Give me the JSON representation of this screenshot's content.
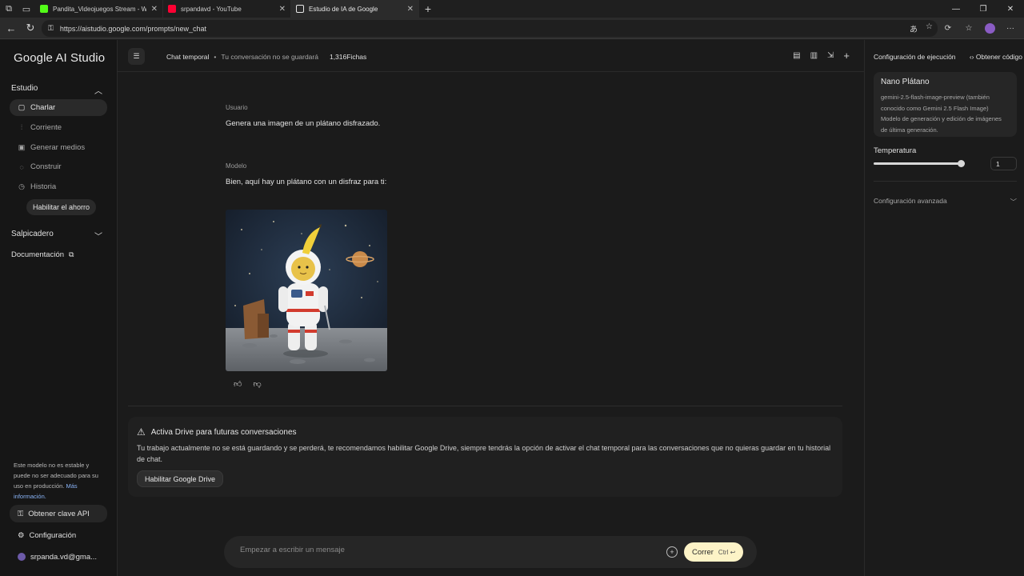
{
  "browser": {
    "tabs": [
      {
        "title": "Pandita_Videojuegos Stream - W",
        "favicon_color": "#53fc18"
      },
      {
        "title": "srpandavd - YouTube",
        "favicon_color": "#ff0033"
      },
      {
        "title": "Estudio de IA de Google",
        "favicon_color": "#e8e8e8"
      }
    ],
    "url": "https://aistudio.google.com/prompts/new_chat"
  },
  "sidebar": {
    "logo": "Google AI Studio",
    "studio_label": "Estudio",
    "items": [
      {
        "label": "Charlar",
        "icon": "chat-icon"
      },
      {
        "label": "Corriente",
        "icon": "stream-icon"
      },
      {
        "label": "Generar medios",
        "icon": "media-icon"
      },
      {
        "label": "Construir",
        "icon": "build-icon"
      },
      {
        "label": "Historia",
        "icon": "history-icon"
      }
    ],
    "saving_button": "Habilitar el ahorro",
    "dashboard_label": "Salpicadero",
    "docs_label": "Documentación",
    "notice_text": "Este modelo no es estable y puede no ser adecuado para su uso en producción.",
    "notice_link": "Más información.",
    "api_key_button": "Obtener clave API",
    "settings_label": "Configuración",
    "account": "srpanda.vd@gma..."
  },
  "header": {
    "chat_title": "Chat temporal",
    "chat_subtitle": "Tu conversación no se guardará",
    "tokens": "1,316Fichas"
  },
  "conversation": {
    "user_label": "Usuario",
    "user_text": "Genera una imagen de un plátano disfrazado.",
    "model_label": "Modelo",
    "model_text": "Bien, aquí hay un plátano con un disfraz para ti:"
  },
  "drive_notice": {
    "title": "Activa Drive para futuras conversaciones",
    "body": "Tu trabajo actualmente no se está guardando y se perderá, te recomendamos habilitar Google Drive, siempre tendrás la opción de activar el chat temporal para las conversaciones que no quieras guardar en tu historial de chat.",
    "button": "Habilitar Google Drive"
  },
  "composer": {
    "placeholder": "Empezar a escribir un mensaje",
    "run_label": "Correr",
    "shortcut": "Ctrl ↩"
  },
  "run_settings": {
    "title": "Configuración de ejecución",
    "get_code": "Obtener código",
    "model_name": "Nano Plátano",
    "model_desc": "gemini-2.5-flash-image-preview (también conocido como Gemini 2.5 Flash Image) Modelo de generación y edición de imágenes de última generación.",
    "temperature_label": "Temperatura",
    "temperature_value": "1",
    "temperature_fraction": 1.0,
    "advanced_label": "Configuración avanzada"
  }
}
